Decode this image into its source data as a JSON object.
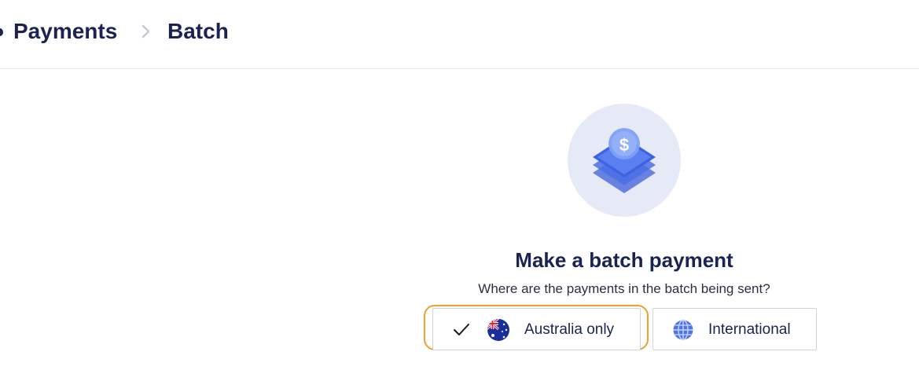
{
  "breadcrumb": {
    "items": [
      {
        "label": "Payments"
      },
      {
        "label": "Batch"
      }
    ],
    "separator_icon": "chevron-right-icon"
  },
  "hero": {
    "icon": "stacked-layers-dollar-icon",
    "circle_color": "#e6eaf7",
    "accent_color": "#3d63e0"
  },
  "content": {
    "title": "Make a batch payment",
    "question": "Where are the payments in the batch being sent?"
  },
  "destination_options": [
    {
      "label": "Australia only",
      "icon": "australia-flag-icon",
      "selected": true,
      "focused": true
    },
    {
      "label": "International",
      "icon": "globe-icon",
      "selected": false,
      "focused": false
    }
  ],
  "colors": {
    "text_primary": "#1a2352",
    "focus_ring": "#f0a030",
    "option_border": "#cfd3dc"
  }
}
